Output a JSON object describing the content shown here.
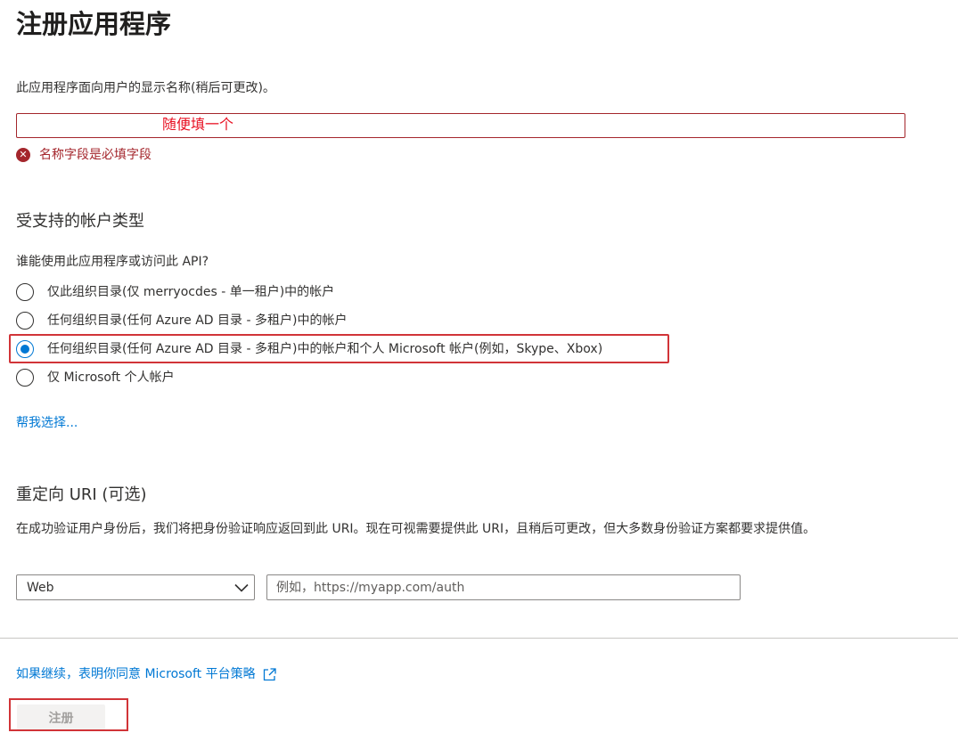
{
  "page": {
    "title": "注册应用程序"
  },
  "name_section": {
    "description": "此应用程序面向用户的显示名称(稍后可更改)。",
    "input_value": "",
    "annotation": "随便填一个",
    "error_text": "名称字段是必填字段",
    "error_icon": "error-circle-icon"
  },
  "account_types": {
    "title": "受支持的帐户类型",
    "question": "谁能使用此应用程序或访问此 API?",
    "options": [
      {
        "label": "仅此组织目录(仅 merryocdes - 单一租户)中的帐户",
        "checked": false
      },
      {
        "label": "任何组织目录(任何 Azure AD 目录 - 多租户)中的帐户",
        "checked": false
      },
      {
        "label": "任何组织目录(任何 Azure AD 目录 - 多租户)中的帐户和个人 Microsoft 帐户(例如，Skype、Xbox)",
        "checked": true
      },
      {
        "label": "仅 Microsoft 个人帐户",
        "checked": false
      }
    ],
    "help_link": "帮我选择..."
  },
  "redirect_uri": {
    "title": "重定向 URI (可选)",
    "description": "在成功验证用户身份后，我们将把身份验证响应返回到此 URI。现在可视需要提供此 URI，且稍后可更改，但大多数身份验证方案都要求提供值。",
    "platform_value": "Web",
    "uri_value": "",
    "uri_placeholder": "例如，https://myapp.com/auth"
  },
  "footer": {
    "policy_link": "如果继续，表明你同意 Microsoft 平台策略",
    "register_label": "注册"
  },
  "colors": {
    "accent": "#0078d4",
    "error": "#a4262c",
    "annotation_red": "#d13438",
    "disabled_bg": "#f3f2f1",
    "disabled_text": "#a19f9d"
  }
}
